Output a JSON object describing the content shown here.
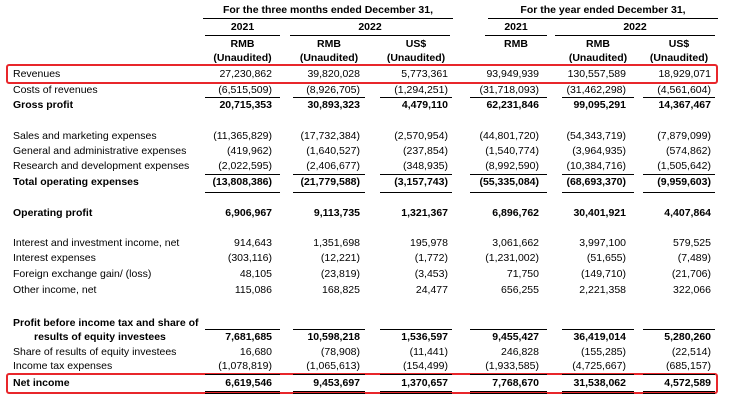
{
  "header": {
    "period_three_months": "For the three months ended December 31,",
    "period_year": "For the year ended December 31,",
    "year_2021": "2021",
    "year_2022": "2022",
    "currency_rmb": "RMB",
    "currency_usd": "US$",
    "unaudited": "(Unaudited)"
  },
  "highlight_color": "#e8262b",
  "rows": [
    {
      "label": "Revenues",
      "bold": false,
      "values": [
        "27,230,862",
        "39,820,028",
        "5,773,361",
        "93,949,939",
        "130,557,589",
        "18,929,071"
      ]
    },
    {
      "label": "Costs of revenues",
      "bold": false,
      "values": [
        "(6,515,509)",
        "(8,926,705)",
        "(1,294,251)",
        "(31,718,093)",
        "(31,462,298)",
        "(4,561,604)"
      ]
    },
    {
      "label": "Gross profit",
      "bold": true,
      "values": [
        "20,715,353",
        "30,893,323",
        "4,479,110",
        "62,231,846",
        "99,095,291",
        "14,367,467"
      ]
    },
    {
      "label": "Sales and marketing expenses",
      "bold": false,
      "values": [
        "(11,365,829)",
        "(17,732,384)",
        "(2,570,954)",
        "(44,801,720)",
        "(54,343,719)",
        "(7,879,099)"
      ]
    },
    {
      "label": "General and administrative expenses",
      "bold": false,
      "values": [
        "(419,962)",
        "(1,640,527)",
        "(237,854)",
        "(1,540,774)",
        "(3,964,935)",
        "(574,862)"
      ]
    },
    {
      "label": "Research and development expenses",
      "bold": false,
      "values": [
        "(2,022,595)",
        "(2,406,677)",
        "(348,935)",
        "(8,992,590)",
        "(10,384,716)",
        "(1,505,642)"
      ]
    },
    {
      "label": "Total operating expenses",
      "bold": true,
      "values": [
        "(13,808,386)",
        "(21,779,588)",
        "(3,157,743)",
        "(55,335,084)",
        "(68,693,370)",
        "(9,959,603)"
      ]
    },
    {
      "label": "Operating profit",
      "bold": true,
      "values": [
        "6,906,967",
        "9,113,735",
        "1,321,367",
        "6,896,762",
        "30,401,921",
        "4,407,864"
      ]
    },
    {
      "label": "Interest and investment income, net",
      "bold": false,
      "values": [
        "914,643",
        "1,351,698",
        "195,978",
        "3,061,662",
        "3,997,100",
        "579,525"
      ]
    },
    {
      "label": "Interest expenses",
      "bold": false,
      "values": [
        "(303,116)",
        "(12,221)",
        "(1,772)",
        "(1,231,002)",
        "(51,655)",
        "(7,489)"
      ]
    },
    {
      "label": "Foreign exchange gain/ (loss)",
      "bold": false,
      "values": [
        "48,105",
        "(23,819)",
        "(3,453)",
        "71,750",
        "(149,710)",
        "(21,706)"
      ]
    },
    {
      "label": "Other income, net",
      "bold": false,
      "values": [
        "115,086",
        "168,825",
        "24,477",
        "656,255",
        "2,221,358",
        "322,066"
      ]
    },
    {
      "label": "Profit before income tax and share of",
      "bold": true,
      "values": [
        "",
        "",
        "",
        "",
        "",
        ""
      ]
    },
    {
      "label": "results of equity investees",
      "bold": true,
      "values": [
        "7,681,685",
        "10,598,218",
        "1,536,597",
        "9,455,427",
        "36,419,014",
        "5,280,260"
      ]
    },
    {
      "label": "Share of results of equity investees",
      "bold": false,
      "values": [
        "16,680",
        "(78,908)",
        "(11,441)",
        "246,828",
        "(155,285)",
        "(22,514)"
      ]
    },
    {
      "label": "Income tax expenses",
      "bold": false,
      "values": [
        "(1,078,819)",
        "(1,065,613)",
        "(154,499)",
        "(1,933,585)",
        "(4,725,667)",
        "(685,157)"
      ]
    },
    {
      "label": "Net income",
      "bold": true,
      "values": [
        "6,619,546",
        "9,453,697",
        "1,370,657",
        "7,768,670",
        "31,538,062",
        "4,572,589"
      ]
    }
  ]
}
